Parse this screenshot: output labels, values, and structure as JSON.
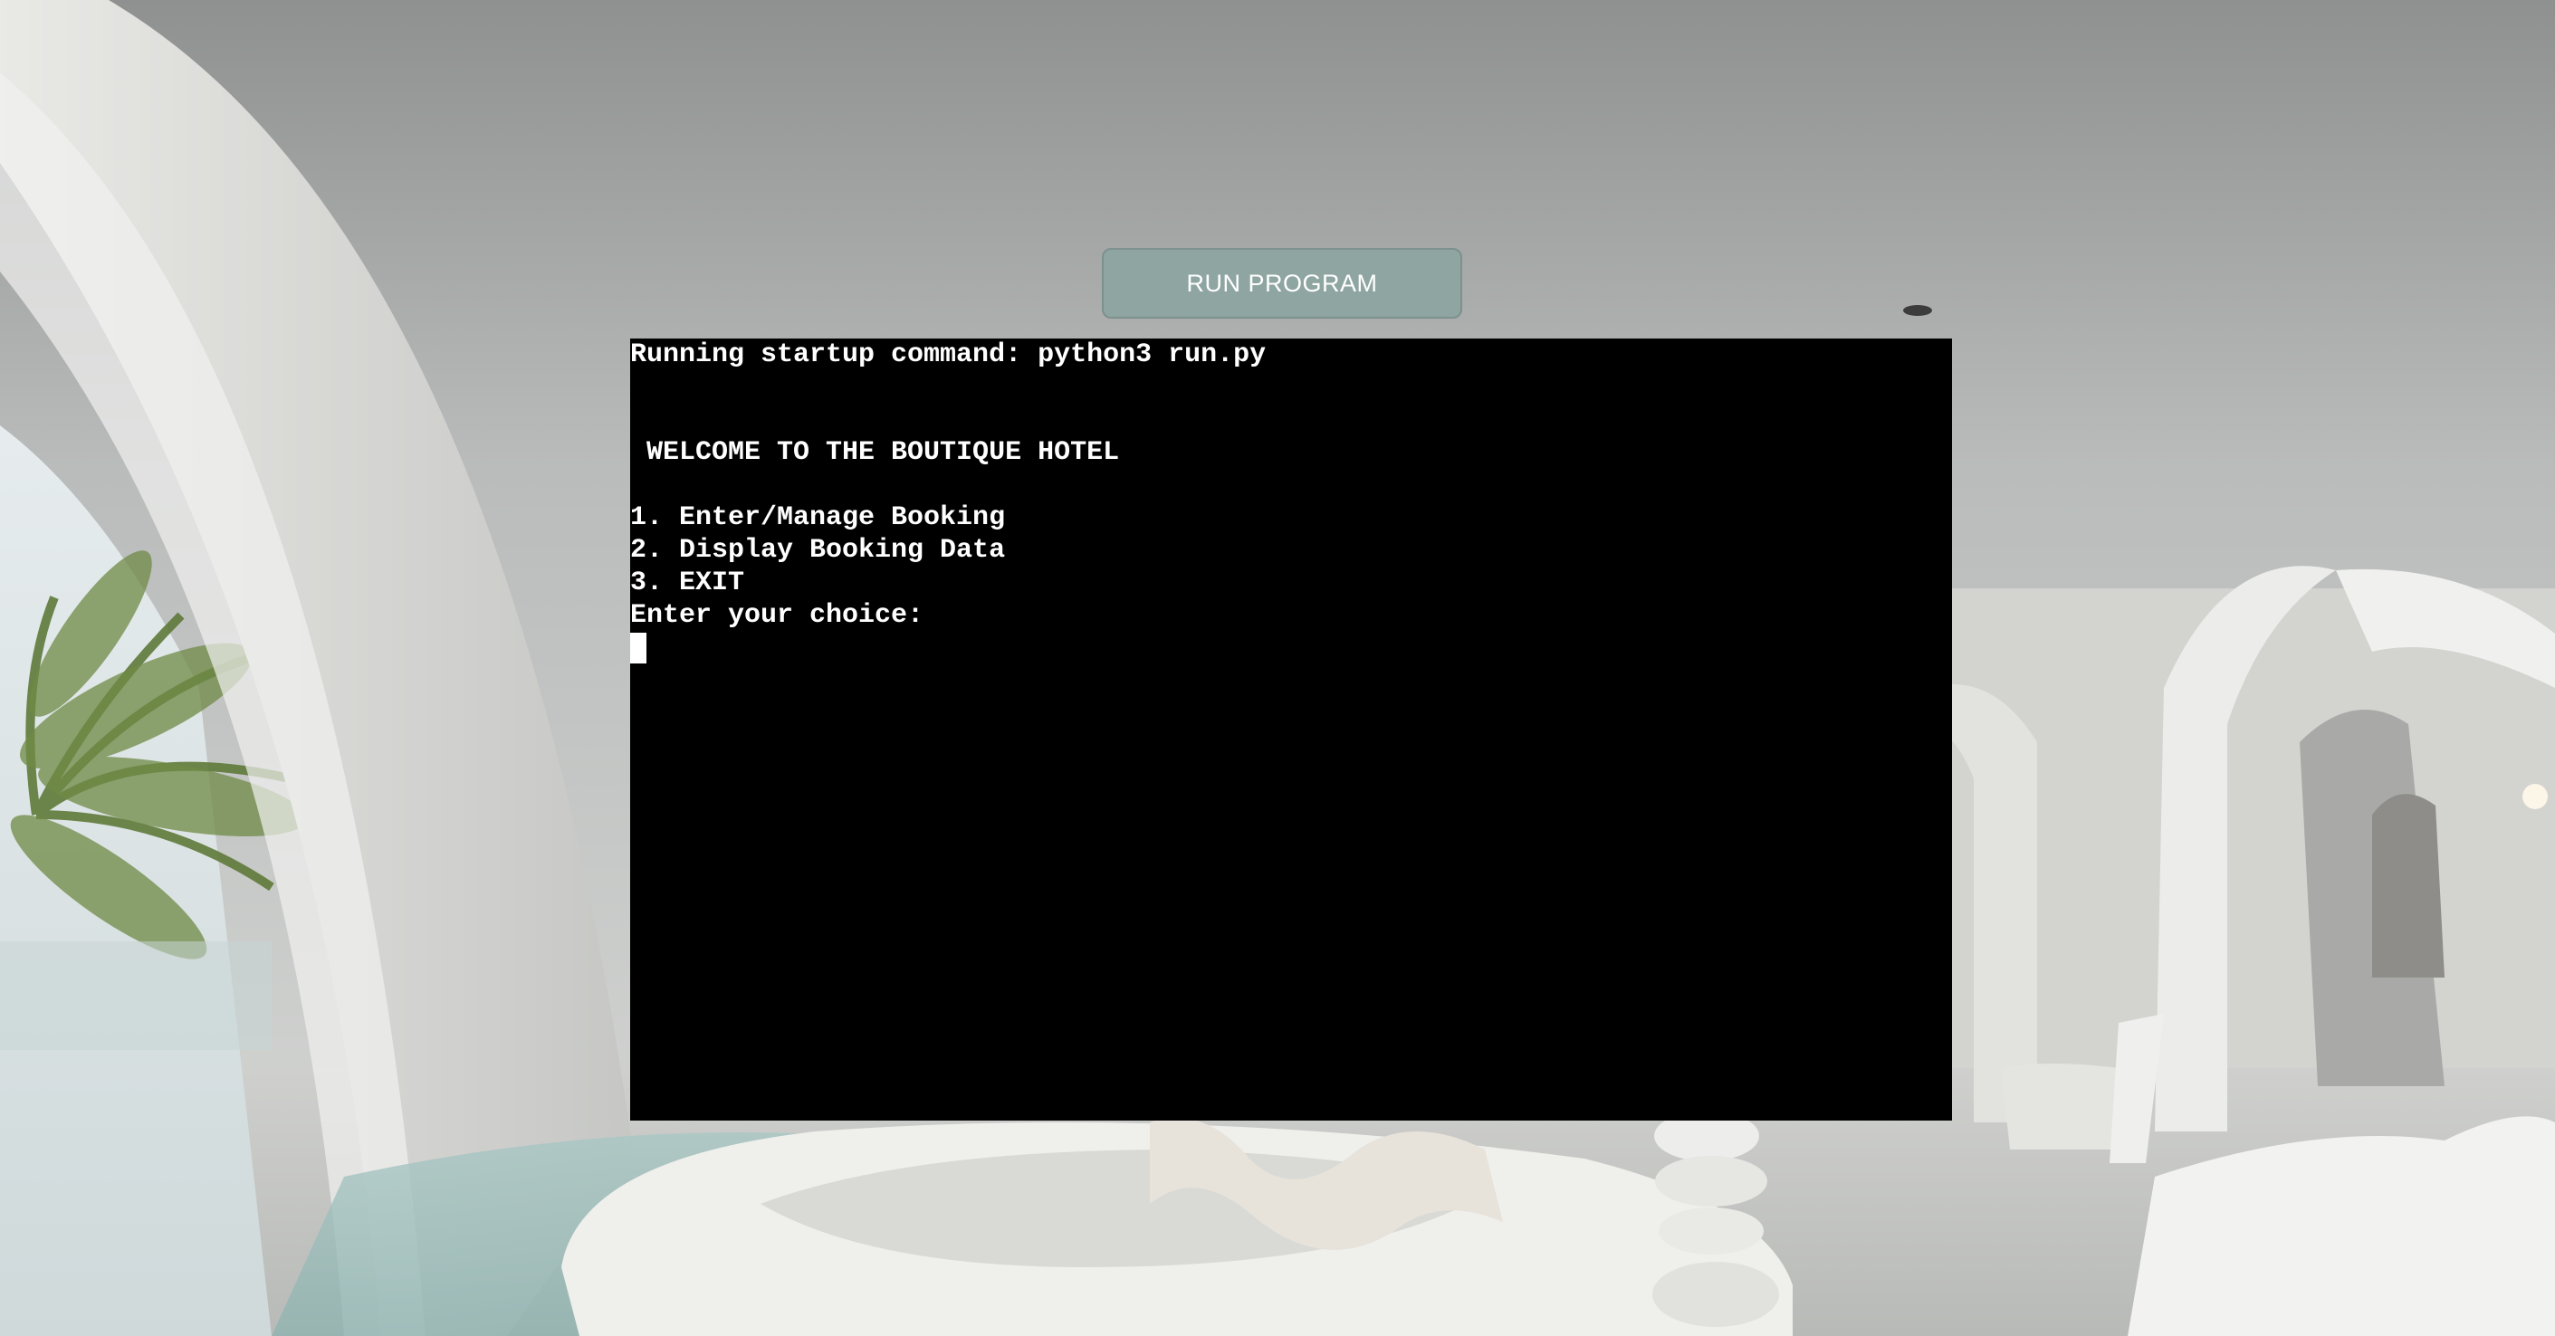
{
  "run_button": {
    "label": "RUN PROGRAM"
  },
  "terminal": {
    "lines": [
      "Running startup command: python3 run.py",
      "",
      "",
      " WELCOME TO THE BOUTIQUE HOTEL",
      "",
      "1. Enter/Manage Booking",
      "2. Display Booking Data",
      "3. EXIT",
      "Enter your choice:"
    ]
  },
  "colors": {
    "button_bg": "#8fa5a2",
    "terminal_bg": "#000000",
    "terminal_text": "#ffffff"
  }
}
